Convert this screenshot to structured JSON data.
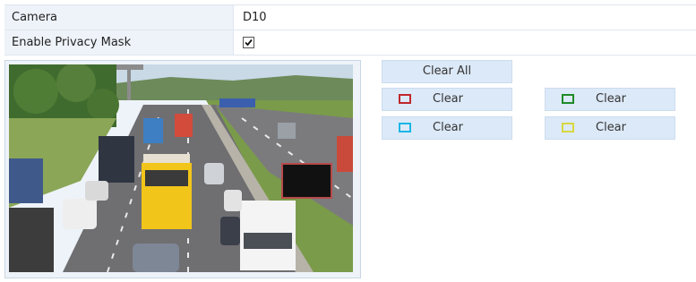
{
  "form": {
    "camera_label": "Camera",
    "camera_value": "D10",
    "privacy_label": "Enable Privacy Mask",
    "privacy_checked": true
  },
  "buttons": {
    "clear_all": "Clear All",
    "clear_1": "Clear",
    "clear_2": "Clear",
    "clear_3": "Clear",
    "clear_4": "Clear"
  },
  "mask_colors": {
    "area_1": "#c0282d",
    "area_2": "#1e8a28",
    "area_3": "#1cb6e6",
    "area_4": "#d8d840"
  },
  "video": {
    "content": "highway traffic camera view"
  }
}
